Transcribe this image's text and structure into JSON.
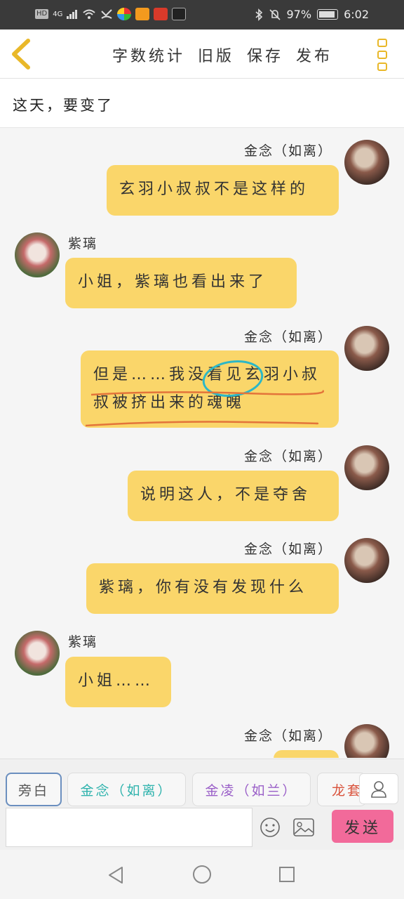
{
  "status_bar": {
    "hd": "HD",
    "network": "4G",
    "battery_pct": "97%",
    "battery_level": 0.97,
    "time": "6:02"
  },
  "nav": {
    "actions": [
      "字数统计",
      "旧版",
      "保存",
      "发布"
    ]
  },
  "title": "这天，要变了",
  "messages": [
    {
      "side": "right",
      "name": "金念（如离）",
      "text": "玄羽小叔叔不是这样的"
    },
    {
      "side": "left",
      "name": "紫璃",
      "text": "小姐，紫璃也看出来了"
    },
    {
      "side": "right",
      "name": "金念（如离）",
      "text": "但是……我没看见玄羽小叔叔被挤出来的魂魄"
    },
    {
      "side": "right",
      "name": "金念（如离）",
      "text": "说明这人，不是夺舍"
    },
    {
      "side": "right",
      "name": "金念（如离）",
      "text": "紫璃，你有没有发现什么"
    },
    {
      "side": "left",
      "name": "紫璃",
      "text": "小姐……"
    },
    {
      "side": "right",
      "name": "金念（如离）",
      "text": ""
    }
  ],
  "speakers": [
    {
      "label": "旁白",
      "color": "#555555"
    },
    {
      "label": "金念（如离）",
      "color": "#2fb3ad"
    },
    {
      "label": "金凌（如兰）",
      "color": "#9a5fc8"
    },
    {
      "label": "龙套",
      "color": "#d9533c"
    }
  ],
  "input": {
    "value": "",
    "send_label": "发送"
  },
  "colors": {
    "bubble": "#fad66a",
    "accent": "#e9b829",
    "send": "#f26a9a"
  }
}
